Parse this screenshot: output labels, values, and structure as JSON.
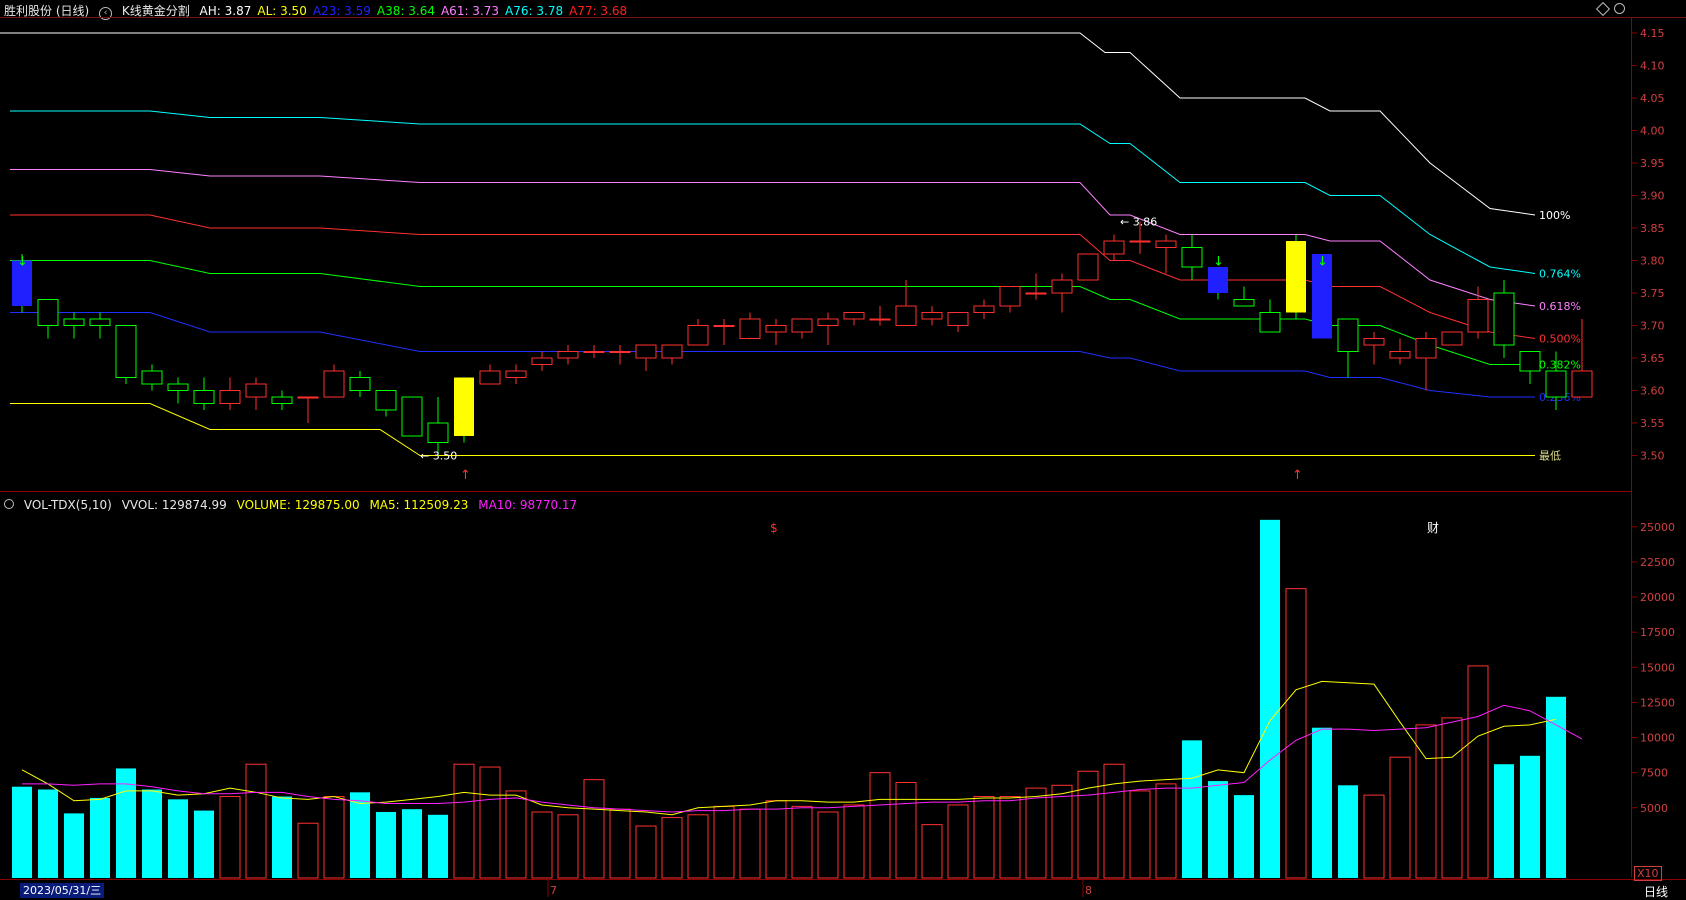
{
  "top_header": {
    "stock_name": "胜利股份 (日线)",
    "indicator_icon": "expand-icon",
    "indicator_name": "K线黄金分割",
    "values": [
      {
        "label": "AH: ",
        "value": "3.87",
        "color": "#ffffff"
      },
      {
        "label": "AL: ",
        "value": "3.50",
        "color": "#ffff00"
      },
      {
        "label": "A23: ",
        "value": "3.59",
        "color": "#2020ff"
      },
      {
        "label": "A38: ",
        "value": "3.64",
        "color": "#00ff00"
      },
      {
        "label": "A61: ",
        "value": "3.73",
        "color": "#ff80ff"
      },
      {
        "label": "A76: ",
        "value": "3.78",
        "color": "#00ffff"
      },
      {
        "label": "A77: ",
        "value": "3.68",
        "color": "#ff2020"
      }
    ]
  },
  "vol_header": {
    "name": "VOL-TDX(5,10)",
    "vvol": "VVOL: 129874.99",
    "volume": "VOLUME: 129875.00",
    "ma5": "MA5: 112509.23",
    "ma10": "MA10: 98770.17"
  },
  "price_axis": [
    "4.15",
    "4.10",
    "4.05",
    "4.00",
    "3.95",
    "3.90",
    "3.85",
    "3.80",
    "3.75",
    "3.70",
    "3.65",
    "3.60",
    "3.55",
    "3.50"
  ],
  "volume_axis": [
    "25000",
    "22500",
    "20000",
    "17500",
    "15000",
    "12500",
    "10000",
    "7500",
    "5000"
  ],
  "fib_labels": [
    "100%",
    "0.764%",
    "0.618%",
    "0.500%",
    "0.382%",
    "0.236%",
    "最低"
  ],
  "annotations": {
    "high": "3.86",
    "low": "3.50",
    "event_s": "$",
    "event_cai": "财"
  },
  "bottom": {
    "date": "2023/05/31/三",
    "month_7": "7",
    "month_8": "8",
    "x10": "X10",
    "period": "日线"
  },
  "colors": {
    "up": "#ff3030",
    "down": "#00ff00",
    "vol_down": "#00ffff",
    "ma5": "#ffff00",
    "ma10": "#ff20ff"
  },
  "chart_data": {
    "type": "candlestick",
    "title": "胜利股份 (日线)",
    "ylim": [
      3.45,
      4.17
    ],
    "candles": [
      {
        "o": 3.8,
        "c": 3.73,
        "h": 3.81,
        "l": 3.72
      },
      {
        "o": 3.74,
        "c": 3.7,
        "h": 3.74,
        "l": 3.68
      },
      {
        "o": 3.71,
        "c": 3.7,
        "h": 3.72,
        "l": 3.68
      },
      {
        "o": 3.71,
        "c": 3.7,
        "h": 3.72,
        "l": 3.68
      },
      {
        "o": 3.7,
        "c": 3.62,
        "h": 3.7,
        "l": 3.61
      },
      {
        "o": 3.63,
        "c": 3.61,
        "h": 3.64,
        "l": 3.6
      },
      {
        "o": 3.61,
        "c": 3.6,
        "h": 3.62,
        "l": 3.58
      },
      {
        "o": 3.6,
        "c": 3.58,
        "h": 3.62,
        "l": 3.57
      },
      {
        "o": 3.58,
        "c": 3.6,
        "h": 3.62,
        "l": 3.57
      },
      {
        "o": 3.59,
        "c": 3.61,
        "h": 3.62,
        "l": 3.57
      },
      {
        "o": 3.59,
        "c": 3.58,
        "h": 3.6,
        "l": 3.57
      },
      {
        "o": 3.59,
        "c": 3.59,
        "h": 3.59,
        "l": 3.55
      },
      {
        "o": 3.59,
        "c": 3.63,
        "h": 3.64,
        "l": 3.59
      },
      {
        "o": 3.62,
        "c": 3.6,
        "h": 3.63,
        "l": 3.59
      },
      {
        "o": 3.6,
        "c": 3.57,
        "h": 3.6,
        "l": 3.56
      },
      {
        "o": 3.59,
        "c": 3.53,
        "h": 3.59,
        "l": 3.53
      },
      {
        "o": 3.55,
        "c": 3.52,
        "h": 3.59,
        "l": 3.5
      },
      {
        "o": 3.53,
        "c": 3.62,
        "h": 3.62,
        "l": 3.52
      },
      {
        "o": 3.61,
        "c": 3.63,
        "h": 3.64,
        "l": 3.61
      },
      {
        "o": 3.62,
        "c": 3.63,
        "h": 3.64,
        "l": 3.61
      },
      {
        "o": 3.64,
        "c": 3.65,
        "h": 3.66,
        "l": 3.63
      },
      {
        "o": 3.65,
        "c": 3.66,
        "h": 3.67,
        "l": 3.64
      },
      {
        "o": 3.66,
        "c": 3.66,
        "h": 3.67,
        "l": 3.65
      },
      {
        "o": 3.66,
        "c": 3.66,
        "h": 3.67,
        "l": 3.64
      },
      {
        "o": 3.65,
        "c": 3.67,
        "h": 3.67,
        "l": 3.63
      },
      {
        "o": 3.65,
        "c": 3.67,
        "h": 3.67,
        "l": 3.64
      },
      {
        "o": 3.67,
        "c": 3.7,
        "h": 3.71,
        "l": 3.67
      },
      {
        "o": 3.7,
        "c": 3.7,
        "h": 3.71,
        "l": 3.67
      },
      {
        "o": 3.68,
        "c": 3.71,
        "h": 3.72,
        "l": 3.68
      },
      {
        "o": 3.69,
        "c": 3.7,
        "h": 3.71,
        "l": 3.67
      },
      {
        "o": 3.69,
        "c": 3.71,
        "h": 3.71,
        "l": 3.68
      },
      {
        "o": 3.7,
        "c": 3.71,
        "h": 3.72,
        "l": 3.67
      },
      {
        "o": 3.71,
        "c": 3.72,
        "h": 3.72,
        "l": 3.7
      },
      {
        "o": 3.71,
        "c": 3.71,
        "h": 3.73,
        "l": 3.7
      },
      {
        "o": 3.7,
        "c": 3.73,
        "h": 3.77,
        "l": 3.7
      },
      {
        "o": 3.71,
        "c": 3.72,
        "h": 3.73,
        "l": 3.7
      },
      {
        "o": 3.7,
        "c": 3.72,
        "h": 3.72,
        "l": 3.69
      },
      {
        "o": 3.72,
        "c": 3.73,
        "h": 3.74,
        "l": 3.71
      },
      {
        "o": 3.73,
        "c": 3.76,
        "h": 3.76,
        "l": 3.72
      },
      {
        "o": 3.75,
        "c": 3.75,
        "h": 3.78,
        "l": 3.74
      },
      {
        "o": 3.75,
        "c": 3.77,
        "h": 3.78,
        "l": 3.72
      },
      {
        "o": 3.77,
        "c": 3.81,
        "h": 3.81,
        "l": 3.77
      },
      {
        "o": 3.81,
        "c": 3.83,
        "h": 3.84,
        "l": 3.8
      },
      {
        "o": 3.83,
        "c": 3.83,
        "h": 3.86,
        "l": 3.81
      },
      {
        "o": 3.82,
        "c": 3.83,
        "h": 3.84,
        "l": 3.78
      },
      {
        "o": 3.82,
        "c": 3.79,
        "h": 3.84,
        "l": 3.77
      },
      {
        "o": 3.79,
        "c": 3.75,
        "h": 3.79,
        "l": 3.74
      },
      {
        "o": 3.74,
        "c": 3.73,
        "h": 3.76,
        "l": 3.73
      },
      {
        "o": 3.72,
        "c": 3.69,
        "h": 3.74,
        "l": 3.69
      },
      {
        "o": 3.72,
        "c": 3.83,
        "h": 3.84,
        "l": 3.71
      },
      {
        "o": 3.81,
        "c": 3.68,
        "h": 3.81,
        "l": 3.68
      },
      {
        "o": 3.71,
        "c": 3.66,
        "h": 3.71,
        "l": 3.62
      },
      {
        "o": 3.67,
        "c": 3.68,
        "h": 3.69,
        "l": 3.64
      },
      {
        "o": 3.65,
        "c": 3.66,
        "h": 3.68,
        "l": 3.64
      },
      {
        "o": 3.65,
        "c": 3.68,
        "h": 3.69,
        "l": 3.6
      },
      {
        "o": 3.67,
        "c": 3.69,
        "h": 3.69,
        "l": 3.67
      },
      {
        "o": 3.69,
        "c": 3.74,
        "h": 3.76,
        "l": 3.68
      },
      {
        "o": 3.75,
        "c": 3.67,
        "h": 3.77,
        "l": 3.65
      },
      {
        "o": 3.66,
        "c": 3.63,
        "h": 3.66,
        "l": 3.61
      },
      {
        "o": 3.63,
        "c": 3.59,
        "h": 3.66,
        "l": 3.57
      },
      {
        "o": 3.59,
        "c": 3.63,
        "h": 3.71,
        "l": 3.59
      }
    ],
    "volume": [
      6500,
      6300,
      4600,
      5700,
      7800,
      6300,
      5600,
      4800,
      5800,
      8100,
      5800,
      3900,
      5800,
      6100,
      4700,
      4900,
      4500,
      8100,
      7900,
      6200,
      4700,
      4500,
      7000,
      4900,
      3700,
      4300,
      4500,
      5100,
      4900,
      5500,
      5100,
      4700,
      5200,
      7500,
      6800,
      3800,
      5200,
      5800,
      5800,
      6400,
      6600,
      7600,
      8100,
      6200,
      6700,
      9800,
      6900,
      5900,
      25500,
      20600,
      10700,
      6600,
      5900,
      8600,
      10900,
      11400,
      15100,
      8100,
      8700,
      12900
    ],
    "ma5": [
      7700,
      6700,
      5500,
      5600,
      6200,
      6200,
      5900,
      6000,
      6400,
      6100,
      5700,
      5600,
      5800,
      5300,
      5400,
      5600,
      5800,
      6100,
      5900,
      5900,
      5200,
      5000,
      4900,
      4800,
      4700,
      4500,
      5000,
      5100,
      5200,
      5500,
      5500,
      5400,
      5400,
      5600,
      5600,
      5600,
      5600,
      5700,
      5700,
      5800,
      6000,
      6400,
      6700,
      6900,
      7000,
      7100,
      7700,
      7500,
      11200,
      13400,
      14000,
      13900,
      13800,
      11100,
      8500,
      8600,
      10100,
      10800,
      10900,
      11300
    ],
    "ma10": [
      6700,
      6700,
      6600,
      6700,
      6700,
      6500,
      6200,
      6000,
      6000,
      6100,
      6100,
      5800,
      5600,
      5500,
      5300,
      5300,
      5300,
      5400,
      5600,
      5700,
      5400,
      5200,
      5000,
      4900,
      4800,
      4700,
      4800,
      4800,
      4900,
      4900,
      5000,
      5000,
      5100,
      5200,
      5300,
      5400,
      5400,
      5500,
      5500,
      5700,
      5800,
      5900,
      6100,
      6300,
      6400,
      6400,
      6600,
      6800,
      8400,
      9800,
      10600,
      10600,
      10500,
      10600,
      10700,
      11100,
      11500,
      12300,
      11900,
      10900,
      9900
    ]
  }
}
